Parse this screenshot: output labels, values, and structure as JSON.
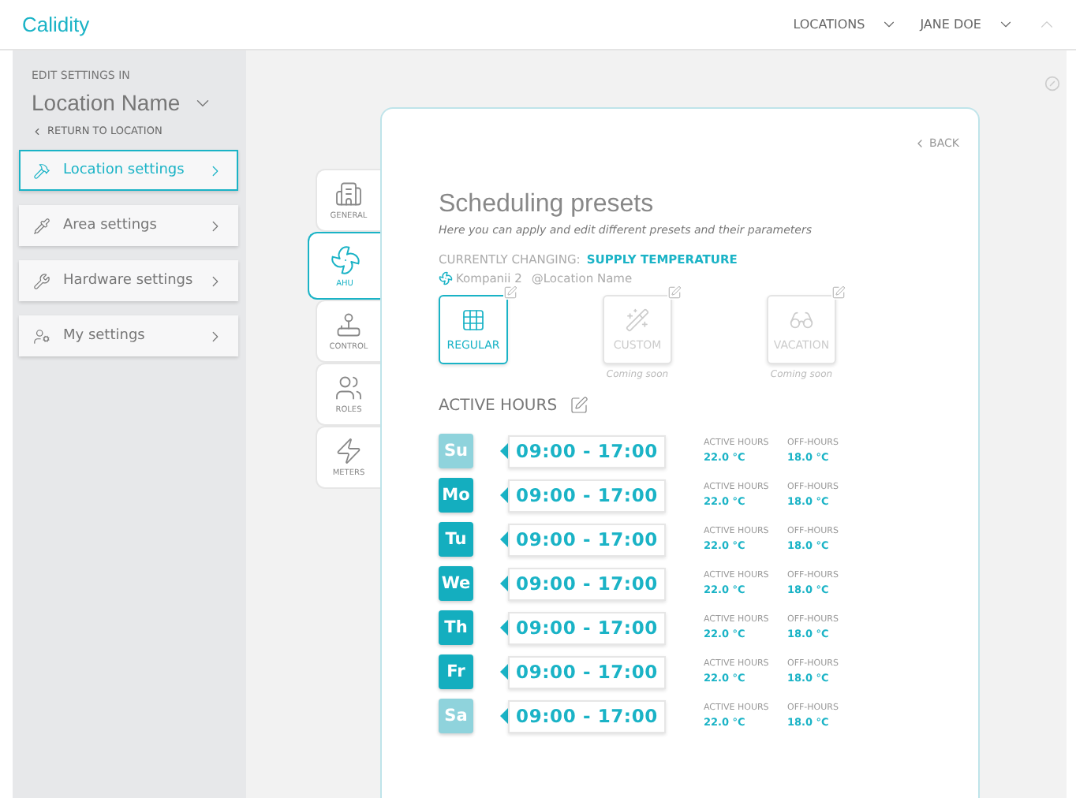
{
  "header": {
    "logo": "Calidity",
    "menus": [
      {
        "label": "LOCATIONS"
      },
      {
        "label": "JANE DOE"
      }
    ]
  },
  "sidebar": {
    "caption": "EDIT SETTINGS IN",
    "location": "Location Name",
    "return_link": "RETURN TO LOCATION",
    "items": [
      {
        "label": "Location settings",
        "kind": "hammer",
        "selected": true
      },
      {
        "label": "Area settings",
        "kind": "pipette",
        "selected": false
      },
      {
        "label": "Hardware settings",
        "kind": "tools",
        "selected": false
      },
      {
        "label": "My settings",
        "kind": "user",
        "selected": false
      }
    ]
  },
  "tabs": [
    {
      "label": "GENERAL",
      "kind": "building",
      "selected": false
    },
    {
      "label": "AHU",
      "kind": "fan",
      "selected": true
    },
    {
      "label": "CONTROL",
      "kind": "joystick",
      "selected": false
    },
    {
      "label": "ROLES",
      "kind": "users",
      "selected": false
    },
    {
      "label": "METERS",
      "kind": "bolt",
      "selected": false
    }
  ],
  "panel": {
    "back": "BACK",
    "title": "Scheduling presets",
    "subtitle": "Here you can apply and edit different presets and their parameters",
    "changing_label": "CURRENTLY CHANGING:",
    "changing_value": "SUPPLY TEMPERATURE",
    "unit": "Kompanii 2",
    "location": "@Location Name",
    "presets": [
      {
        "label": "REGULAR",
        "kind": "grid",
        "selected": true,
        "disabled": false
      },
      {
        "label": "CUSTOM",
        "kind": "wand",
        "selected": false,
        "disabled": true,
        "note": "Coming soon"
      },
      {
        "label": "VACATION",
        "kind": "glasses",
        "selected": false,
        "disabled": true,
        "note": "Coming soon"
      }
    ],
    "section": "ACTIVE HOURS",
    "days": [
      {
        "day": "Su",
        "enabled": false,
        "hours": "09:00 - 17:00",
        "active_label": "ACTIVE HOURS",
        "active_temp": "22.0 °C",
        "off_label": "OFF-HOURS",
        "off_temp": "18.0 °C"
      },
      {
        "day": "Mo",
        "enabled": true,
        "hours": "09:00 - 17:00",
        "active_label": "ACTIVE HOURS",
        "active_temp": "22.0 °C",
        "off_label": "OFF-HOURS",
        "off_temp": "18.0 °C"
      },
      {
        "day": "Tu",
        "enabled": true,
        "hours": "09:00 - 17:00",
        "active_label": "ACTIVE HOURS",
        "active_temp": "22.0 °C",
        "off_label": "OFF-HOURS",
        "off_temp": "18.0 °C"
      },
      {
        "day": "We",
        "enabled": true,
        "hours": "09:00 - 17:00",
        "active_label": "ACTIVE HOURS",
        "active_temp": "22.0 °C",
        "off_label": "OFF-HOURS",
        "off_temp": "18.0 °C"
      },
      {
        "day": "Th",
        "enabled": true,
        "hours": "09:00 - 17:00",
        "active_label": "ACTIVE HOURS",
        "active_temp": "22.0 °C",
        "off_label": "OFF-HOURS",
        "off_temp": "18.0 °C"
      },
      {
        "day": "Fr",
        "enabled": true,
        "hours": "09:00 - 17:00",
        "active_label": "ACTIVE HOURS",
        "active_temp": "22.0 °C",
        "off_label": "OFF-HOURS",
        "off_temp": "18.0 °C"
      },
      {
        "day": "Sa",
        "enabled": false,
        "hours": "09:00 - 17:00",
        "active_label": "ACTIVE HOURS",
        "active_temp": "22.0 °C",
        "off_label": "OFF-HOURS",
        "off_temp": "18.0 °C"
      }
    ]
  }
}
